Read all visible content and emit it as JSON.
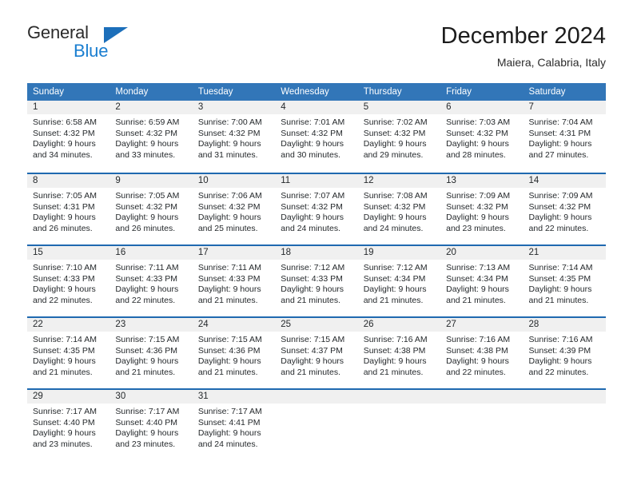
{
  "brand": {
    "name_part1": "General",
    "name_part2": "Blue",
    "accent_color": "#1a7ed0",
    "triangle_color": "#1c6fba"
  },
  "header": {
    "title": "December 2024",
    "subtitle": "Maiera, Calabria, Italy"
  },
  "theme": {
    "header_bg": "#3276b8",
    "header_text": "#ffffff",
    "week_divider": "#1f69b0",
    "day_band_bg": "#f0f0f0",
    "body_text": "#25292c"
  },
  "weekdays": [
    "Sunday",
    "Monday",
    "Tuesday",
    "Wednesday",
    "Thursday",
    "Friday",
    "Saturday"
  ],
  "weeks": [
    [
      {
        "day": "1",
        "sunrise": "Sunrise: 6:58 AM",
        "sunset": "Sunset: 4:32 PM",
        "daylight_line1": "Daylight: 9 hours",
        "daylight_line2": "and 34 minutes."
      },
      {
        "day": "2",
        "sunrise": "Sunrise: 6:59 AM",
        "sunset": "Sunset: 4:32 PM",
        "daylight_line1": "Daylight: 9 hours",
        "daylight_line2": "and 33 minutes."
      },
      {
        "day": "3",
        "sunrise": "Sunrise: 7:00 AM",
        "sunset": "Sunset: 4:32 PM",
        "daylight_line1": "Daylight: 9 hours",
        "daylight_line2": "and 31 minutes."
      },
      {
        "day": "4",
        "sunrise": "Sunrise: 7:01 AM",
        "sunset": "Sunset: 4:32 PM",
        "daylight_line1": "Daylight: 9 hours",
        "daylight_line2": "and 30 minutes."
      },
      {
        "day": "5",
        "sunrise": "Sunrise: 7:02 AM",
        "sunset": "Sunset: 4:32 PM",
        "daylight_line1": "Daylight: 9 hours",
        "daylight_line2": "and 29 minutes."
      },
      {
        "day": "6",
        "sunrise": "Sunrise: 7:03 AM",
        "sunset": "Sunset: 4:32 PM",
        "daylight_line1": "Daylight: 9 hours",
        "daylight_line2": "and 28 minutes."
      },
      {
        "day": "7",
        "sunrise": "Sunrise: 7:04 AM",
        "sunset": "Sunset: 4:31 PM",
        "daylight_line1": "Daylight: 9 hours",
        "daylight_line2": "and 27 minutes."
      }
    ],
    [
      {
        "day": "8",
        "sunrise": "Sunrise: 7:05 AM",
        "sunset": "Sunset: 4:31 PM",
        "daylight_line1": "Daylight: 9 hours",
        "daylight_line2": "and 26 minutes."
      },
      {
        "day": "9",
        "sunrise": "Sunrise: 7:05 AM",
        "sunset": "Sunset: 4:32 PM",
        "daylight_line1": "Daylight: 9 hours",
        "daylight_line2": "and 26 minutes."
      },
      {
        "day": "10",
        "sunrise": "Sunrise: 7:06 AM",
        "sunset": "Sunset: 4:32 PM",
        "daylight_line1": "Daylight: 9 hours",
        "daylight_line2": "and 25 minutes."
      },
      {
        "day": "11",
        "sunrise": "Sunrise: 7:07 AM",
        "sunset": "Sunset: 4:32 PM",
        "daylight_line1": "Daylight: 9 hours",
        "daylight_line2": "and 24 minutes."
      },
      {
        "day": "12",
        "sunrise": "Sunrise: 7:08 AM",
        "sunset": "Sunset: 4:32 PM",
        "daylight_line1": "Daylight: 9 hours",
        "daylight_line2": "and 24 minutes."
      },
      {
        "day": "13",
        "sunrise": "Sunrise: 7:09 AM",
        "sunset": "Sunset: 4:32 PM",
        "daylight_line1": "Daylight: 9 hours",
        "daylight_line2": "and 23 minutes."
      },
      {
        "day": "14",
        "sunrise": "Sunrise: 7:09 AM",
        "sunset": "Sunset: 4:32 PM",
        "daylight_line1": "Daylight: 9 hours",
        "daylight_line2": "and 22 minutes."
      }
    ],
    [
      {
        "day": "15",
        "sunrise": "Sunrise: 7:10 AM",
        "sunset": "Sunset: 4:33 PM",
        "daylight_line1": "Daylight: 9 hours",
        "daylight_line2": "and 22 minutes."
      },
      {
        "day": "16",
        "sunrise": "Sunrise: 7:11 AM",
        "sunset": "Sunset: 4:33 PM",
        "daylight_line1": "Daylight: 9 hours",
        "daylight_line2": "and 22 minutes."
      },
      {
        "day": "17",
        "sunrise": "Sunrise: 7:11 AM",
        "sunset": "Sunset: 4:33 PM",
        "daylight_line1": "Daylight: 9 hours",
        "daylight_line2": "and 21 minutes."
      },
      {
        "day": "18",
        "sunrise": "Sunrise: 7:12 AM",
        "sunset": "Sunset: 4:33 PM",
        "daylight_line1": "Daylight: 9 hours",
        "daylight_line2": "and 21 minutes."
      },
      {
        "day": "19",
        "sunrise": "Sunrise: 7:12 AM",
        "sunset": "Sunset: 4:34 PM",
        "daylight_line1": "Daylight: 9 hours",
        "daylight_line2": "and 21 minutes."
      },
      {
        "day": "20",
        "sunrise": "Sunrise: 7:13 AM",
        "sunset": "Sunset: 4:34 PM",
        "daylight_line1": "Daylight: 9 hours",
        "daylight_line2": "and 21 minutes."
      },
      {
        "day": "21",
        "sunrise": "Sunrise: 7:14 AM",
        "sunset": "Sunset: 4:35 PM",
        "daylight_line1": "Daylight: 9 hours",
        "daylight_line2": "and 21 minutes."
      }
    ],
    [
      {
        "day": "22",
        "sunrise": "Sunrise: 7:14 AM",
        "sunset": "Sunset: 4:35 PM",
        "daylight_line1": "Daylight: 9 hours",
        "daylight_line2": "and 21 minutes."
      },
      {
        "day": "23",
        "sunrise": "Sunrise: 7:15 AM",
        "sunset": "Sunset: 4:36 PM",
        "daylight_line1": "Daylight: 9 hours",
        "daylight_line2": "and 21 minutes."
      },
      {
        "day": "24",
        "sunrise": "Sunrise: 7:15 AM",
        "sunset": "Sunset: 4:36 PM",
        "daylight_line1": "Daylight: 9 hours",
        "daylight_line2": "and 21 minutes."
      },
      {
        "day": "25",
        "sunrise": "Sunrise: 7:15 AM",
        "sunset": "Sunset: 4:37 PM",
        "daylight_line1": "Daylight: 9 hours",
        "daylight_line2": "and 21 minutes."
      },
      {
        "day": "26",
        "sunrise": "Sunrise: 7:16 AM",
        "sunset": "Sunset: 4:38 PM",
        "daylight_line1": "Daylight: 9 hours",
        "daylight_line2": "and 21 minutes."
      },
      {
        "day": "27",
        "sunrise": "Sunrise: 7:16 AM",
        "sunset": "Sunset: 4:38 PM",
        "daylight_line1": "Daylight: 9 hours",
        "daylight_line2": "and 22 minutes."
      },
      {
        "day": "28",
        "sunrise": "Sunrise: 7:16 AM",
        "sunset": "Sunset: 4:39 PM",
        "daylight_line1": "Daylight: 9 hours",
        "daylight_line2": "and 22 minutes."
      }
    ],
    [
      {
        "day": "29",
        "sunrise": "Sunrise: 7:17 AM",
        "sunset": "Sunset: 4:40 PM",
        "daylight_line1": "Daylight: 9 hours",
        "daylight_line2": "and 23 minutes."
      },
      {
        "day": "30",
        "sunrise": "Sunrise: 7:17 AM",
        "sunset": "Sunset: 4:40 PM",
        "daylight_line1": "Daylight: 9 hours",
        "daylight_line2": "and 23 minutes."
      },
      {
        "day": "31",
        "sunrise": "Sunrise: 7:17 AM",
        "sunset": "Sunset: 4:41 PM",
        "daylight_line1": "Daylight: 9 hours",
        "daylight_line2": "and 24 minutes."
      },
      {
        "day": "",
        "sunrise": "",
        "sunset": "",
        "daylight_line1": "",
        "daylight_line2": ""
      },
      {
        "day": "",
        "sunrise": "",
        "sunset": "",
        "daylight_line1": "",
        "daylight_line2": ""
      },
      {
        "day": "",
        "sunrise": "",
        "sunset": "",
        "daylight_line1": "",
        "daylight_line2": ""
      },
      {
        "day": "",
        "sunrise": "",
        "sunset": "",
        "daylight_line1": "",
        "daylight_line2": ""
      }
    ]
  ]
}
